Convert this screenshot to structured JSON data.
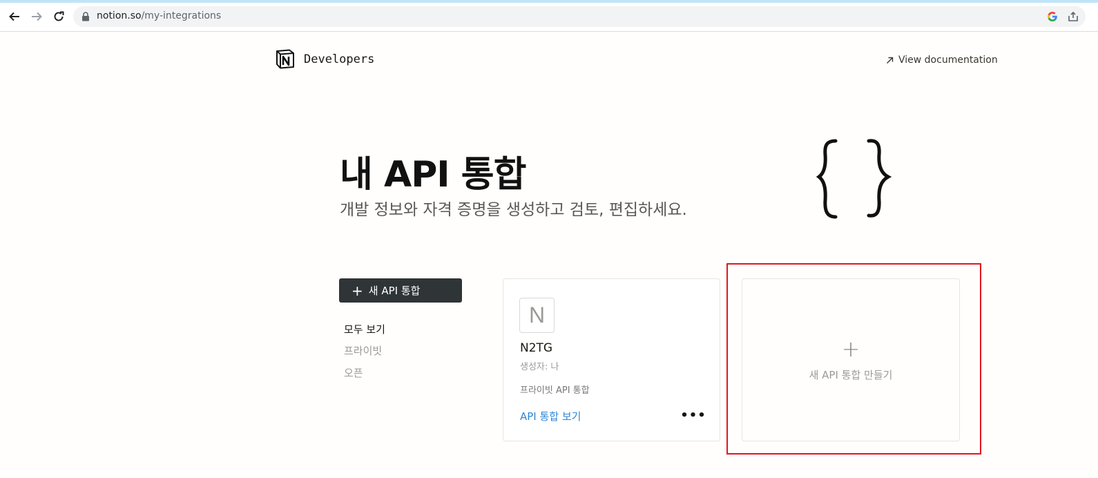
{
  "browser": {
    "url_host": "notion.so",
    "url_path": "/my-integrations"
  },
  "header": {
    "brand": "Developers",
    "docs_link": "View documentation"
  },
  "hero": {
    "title": "내 API 통합",
    "subtitle": "개발 정보와 자격 증명을 생성하고 검토, 편집하세요."
  },
  "sidebar": {
    "new_button": "새 API 통합",
    "filters": [
      {
        "label": "모두 보기",
        "active": true
      },
      {
        "label": "프라이빗",
        "active": false
      },
      {
        "label": "오픈",
        "active": false
      }
    ]
  },
  "integration_card": {
    "avatar_letter": "N",
    "name": "N2TG",
    "creator": "생성자: 나",
    "type": "프라이빗 API 통합",
    "view_link": "API 통합 보기",
    "more": "•••"
  },
  "new_card": {
    "plus": "+",
    "label": "새 API 통합 만들기"
  },
  "colors": {
    "accent_link": "#2e85d6",
    "button_dark": "#2f3437",
    "highlight_red": "#e0161c"
  }
}
